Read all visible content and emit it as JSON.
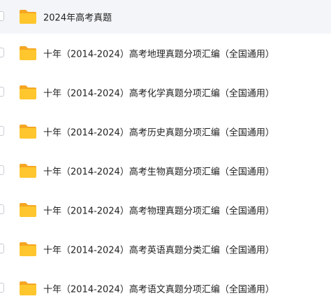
{
  "file_list": {
    "items": [
      {
        "name": "2024年高考真题"
      },
      {
        "name": "十年（2014-2024）高考地理真题分项汇编（全国通用）"
      },
      {
        "name": "十年（2014-2024）高考化学真题分项汇编（全国通用）"
      },
      {
        "name": "十年（2014-2024）高考历史真题分项汇编（全国通用）"
      },
      {
        "name": "十年（2014-2024）高考生物真题分项汇编（全国通用）"
      },
      {
        "name": "十年（2014-2024）高考物理真题分项汇编（全国通用）"
      },
      {
        "name": "十年（2014-2024）高考英语真题分类汇编（全国通用）"
      },
      {
        "name": "十年（2014-2024）高考语文真题分项汇编（全国通用）"
      }
    ]
  },
  "icons": {
    "folder": "folder-icon",
    "folder_color": "#FFC62E",
    "folder_tab_color": "#F5A623"
  }
}
